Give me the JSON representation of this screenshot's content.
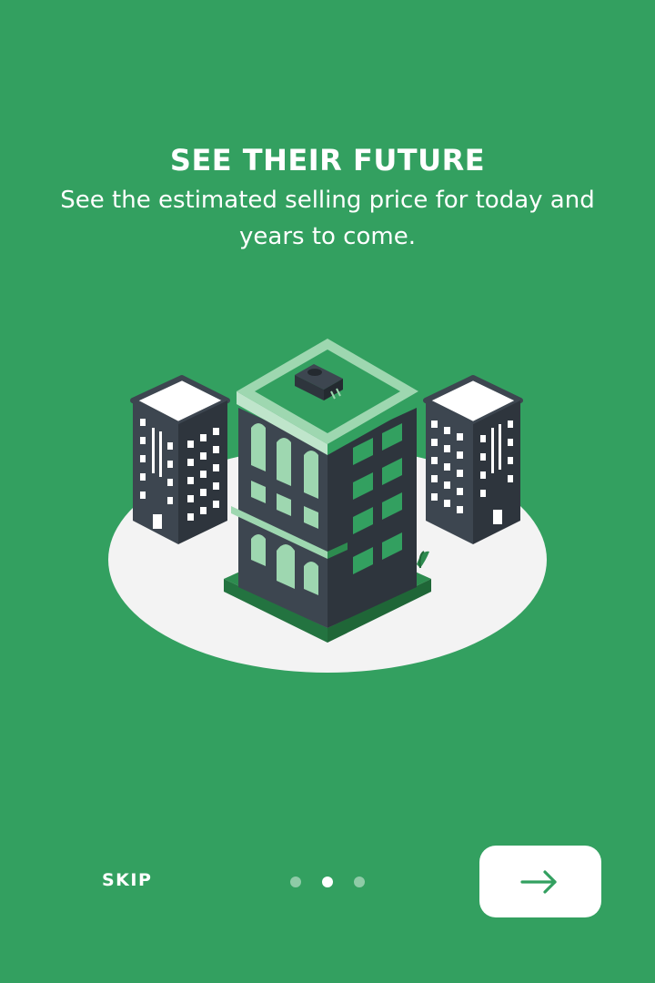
{
  "onboarding": {
    "title": "SEE THEIR FUTURE",
    "subtitle": "See the estimated selling price for today and years to come.",
    "skip_label": "SKIP",
    "page_indicator": {
      "total": 3,
      "active_index": 1
    },
    "next_button": {
      "icon": "arrow-right-icon"
    }
  },
  "colors": {
    "background": "#33a060",
    "building_dark": "#3d4650",
    "accent_light_green": "#9ed7b0",
    "ground": "#f3f3f3"
  }
}
